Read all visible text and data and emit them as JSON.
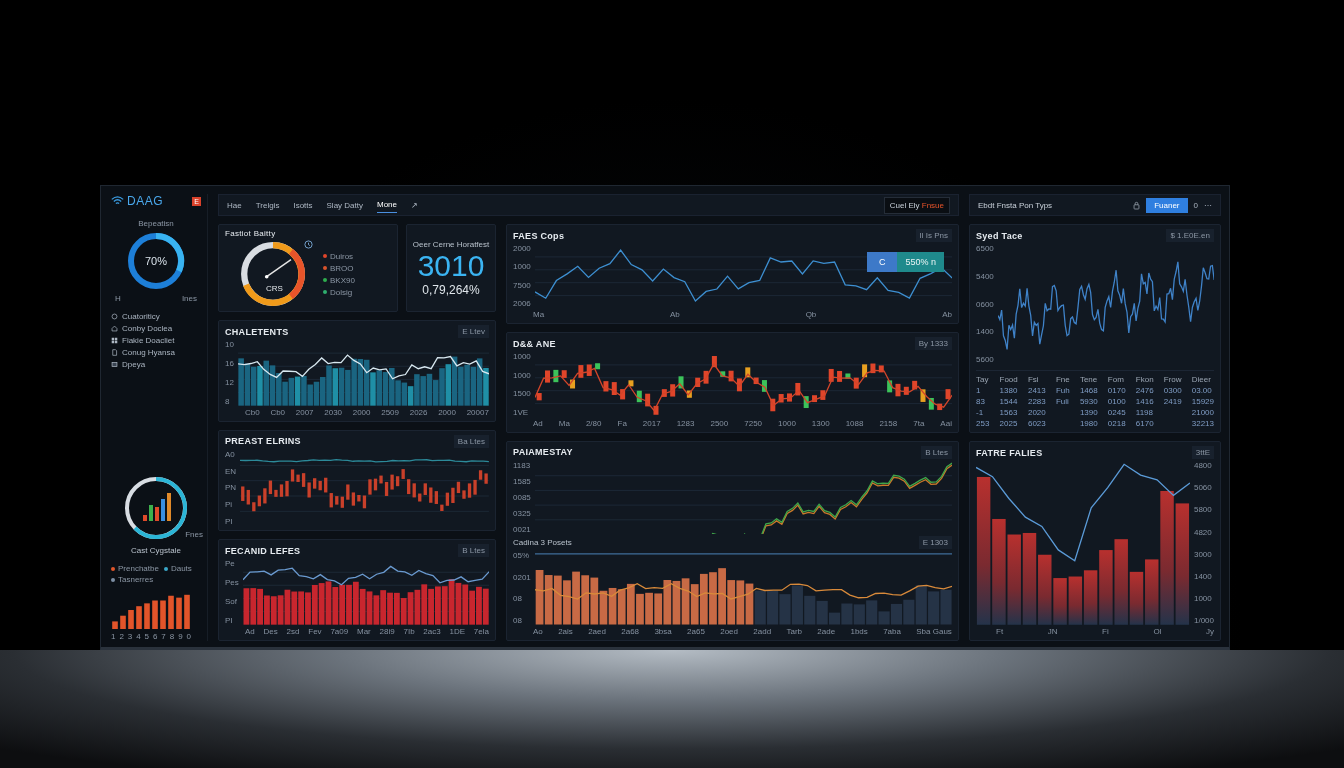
{
  "sidebar": {
    "logo": "DAAG",
    "badge": "E",
    "donut_label": "Bepeatisn",
    "donut_value": "70%",
    "donut_left": "H",
    "donut_right": "Ines",
    "nav": [
      {
        "label": "Cuatoriticy"
      },
      {
        "label": "Conby Doclea"
      },
      {
        "label": "Fiakie Doacliet"
      },
      {
        "label": "Conug Hyansa"
      },
      {
        "label": "Dpeya"
      }
    ],
    "donut2_note": "Fnes",
    "donut2_label": "Cast Cygstale",
    "legend": [
      {
        "label": "Prenchatbe",
        "color": "#e0562a"
      },
      {
        "label": "Dauts",
        "color": "#3aa7c8"
      },
      {
        "label": "Tasnerres",
        "color": "#7d8ea3"
      }
    ],
    "bar_xticks": [
      "1",
      "2",
      "3",
      "4",
      "5",
      "6",
      "7",
      "8",
      "9",
      "0"
    ]
  },
  "main": {
    "tabs": [
      {
        "label": "Hae",
        "selected": false
      },
      {
        "label": "Trelgis",
        "selected": false
      },
      {
        "label": "Isotts",
        "selected": false
      },
      {
        "label": "Slay Datty",
        "selected": false
      },
      {
        "label": "Mone",
        "selected": true
      },
      {
        "label": "↗",
        "selected": false
      }
    ],
    "action": "Cuel Ely",
    "action_alert": "Fnsue",
    "gauge_card": {
      "title": "Fastiot Baitty",
      "center": "CRS",
      "legend": [
        {
          "label": "Duiros",
          "color": "#e0452a"
        },
        {
          "label": "BROO",
          "color": "#d9542c"
        },
        {
          "label": "BKX90",
          "color": "#2fae4e"
        },
        {
          "label": "Dolsig",
          "color": "#2fae6e"
        }
      ]
    },
    "kpi_card": {
      "title": "Oeer Cerne Horatfest",
      "value": "3010",
      "change": "0,79,264%"
    },
    "left_charts": [
      {
        "kind": "bars-line",
        "title": "CHALETENTS",
        "chip": "E Ltev",
        "yticks": [
          "10",
          "16",
          "12",
          "8"
        ],
        "xticks": [
          "Cb0",
          "Cb0",
          "2007",
          "2030",
          "2000",
          "2509",
          "2026",
          "2000",
          "20007"
        ]
      },
      {
        "kind": "red-candles",
        "title": "PREAST ELRINS",
        "chip": "Ba Ltes",
        "yticks": [
          "A0",
          "EN",
          "PN",
          "Pi",
          "PI"
        ]
      },
      {
        "kind": "red-bars-line",
        "title": "FECANID LEFES",
        "chip": "B Ltes",
        "yticks": [
          "Pe",
          "Pes",
          "Sof",
          "PI"
        ],
        "xticks": [
          "Ad",
          "Des",
          "2sd",
          "Fev",
          "7a09",
          "Mar",
          "28i9",
          "7Ib",
          "2ac3",
          "1DE",
          "7ela"
        ]
      }
    ],
    "right_charts": [
      {
        "kind": "line",
        "title": "FAES Cops",
        "chip": "Il Is Pns",
        "yticks": [
          "2000",
          "1000",
          "7500",
          "2006"
        ],
        "xticks": [
          "Ma",
          "Ab",
          "Qb",
          "Ab"
        ],
        "tooltip": {
          "marker": "C",
          "value": "550% n"
        }
      },
      {
        "kind": "candles",
        "title": "D&& ANE",
        "chip": "By 1333",
        "yticks": [
          "1000",
          "1000",
          "1500",
          "1VE"
        ],
        "xticks": [
          "Ad",
          "Ma",
          "2/80",
          "Fa",
          "2017",
          "1283",
          "2500",
          "7250",
          "1000",
          "1300",
          "1088",
          "2158",
          "7ta",
          "Aai"
        ]
      },
      {
        "kind": "multi",
        "title": "PAIAMESTAY",
        "chip": "B Ltes",
        "yticks": [
          "1183",
          "1585",
          "0085",
          "0325",
          "0021"
        ],
        "subchart": {
          "title": "Cadina 3 Posets",
          "chip": "E 1303",
          "yticks": [
            "05%",
            "0201",
            "08",
            "08"
          ]
        },
        "xticks": [
          "Ao",
          "2ais",
          "2aed",
          "2a68",
          "3bsa",
          "2a65",
          "2oed",
          "2add",
          "Tarb",
          "2ade",
          "1bds",
          "7aba",
          "Sba Gaus"
        ]
      }
    ]
  },
  "side_panel": {
    "toolbar": {
      "title": "Ebdt Fnsta Pon Typs",
      "button": "Fuaner",
      "count": "0",
      "more": "⋯"
    },
    "charts": [
      {
        "kind": "line-dense",
        "title": "Syed Tace",
        "chip": "$ 1.E0E.en",
        "yticks": [
          "6500",
          "5400",
          "0600",
          "1400",
          "5600"
        ],
        "table": {
          "columns": [
            {
              "label": "Tay"
            },
            {
              "label": "Food"
            },
            {
              "label": "Fsi"
            },
            {
              "label": "Fne"
            },
            {
              "label": "Tene"
            },
            {
              "label": "Fom"
            },
            {
              "label": "Fkon"
            },
            {
              "label": "Frow"
            },
            {
              "label": "Dieer"
            }
          ],
          "rows": [
            [
              "1",
              "1380",
              "2413",
              "Fuh",
              "1468",
              "0170",
              "2476",
              "0300",
              "03.00"
            ],
            [
              "83",
              "1544",
              "2283",
              "Fuli",
              "5930",
              "0100",
              "1416",
              "2419",
              "15929"
            ],
            [
              "-1",
              "1563",
              "2020",
              null,
              "1390",
              "0245",
              "1198",
              null,
              "21000"
            ],
            [
              "253",
              "2025",
              "6023",
              null,
              "1980",
              "0218",
              "6170",
              null,
              "32213"
            ]
          ]
        }
      },
      {
        "kind": "red-bars-right",
        "title": "FATRE FALIES",
        "chip": "3ttE",
        "yticks": [
          "4800",
          "5060",
          "5800",
          "4820",
          "3000",
          "1400",
          "1000",
          "1/000"
        ],
        "xticks": [
          "Ft",
          "JN",
          "Fi",
          "Ol",
          "Jy"
        ]
      }
    ]
  }
}
